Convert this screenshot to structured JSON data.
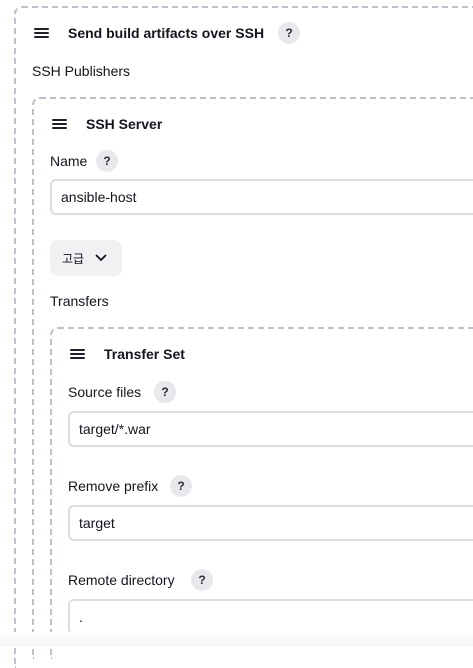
{
  "publisher_section": {
    "title": "Send build artifacts over SSH",
    "help": "?",
    "publishers_label": "SSH Publishers"
  },
  "ssh_server": {
    "title": "SSH Server",
    "name_label": "Name",
    "help": "?",
    "name_value": "ansible-host",
    "advanced_label": "고급",
    "transfers_label": "Transfers"
  },
  "transfer_set": {
    "title": "Transfer Set",
    "fields": [
      {
        "label": "Source files",
        "help": "?",
        "value": "target/*.war"
      },
      {
        "label": "Remove prefix",
        "help": "?",
        "value": "target"
      },
      {
        "label": "Remote directory",
        "help": "?",
        "value": "."
      }
    ]
  },
  "icons": [
    "drag-handle-icon",
    "help-icon",
    "chevron-down-icon"
  ],
  "colors": {
    "dashed_border": "#b8c2cc",
    "input_border": "#dcdce0",
    "help_bg": "#e8e8ec",
    "button_bg": "#f1f1f4"
  }
}
